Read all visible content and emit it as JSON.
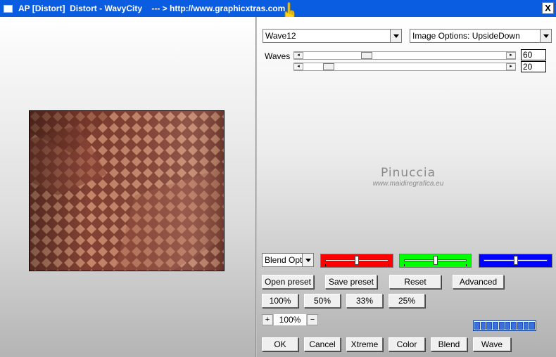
{
  "window": {
    "title": "AP [Distort]  Distort - WavyCity    --- > http://www.graphicxtras.com",
    "close_label": "X"
  },
  "preset_combo": {
    "value": "Wave12"
  },
  "options_combo": {
    "value": "Image Options: UpsideDown"
  },
  "waves": {
    "label": "Waves",
    "slider1": {
      "value": "60",
      "fraction": 0.36
    },
    "slider2": {
      "value": "20",
      "fraction": 0.12
    }
  },
  "watermark": {
    "name": "Pinuccia",
    "url": "www.maidiregrafica.eu"
  },
  "blend_combo": {
    "value": "Blend Optio"
  },
  "color_sliders": [
    {
      "name": "red",
      "color": "#ff0000",
      "fraction": 0.5
    },
    {
      "name": "green",
      "color": "#00ff00",
      "fraction": 0.5
    },
    {
      "name": "blue",
      "color": "#0000ff",
      "fraction": 0.5
    }
  ],
  "buttons": {
    "open_preset": "Open preset",
    "save_preset": "Save preset",
    "reset": "Reset",
    "advanced": "Advanced",
    "zoom100": "100%",
    "zoom50": "50%",
    "zoom33": "33%",
    "zoom25": "25%",
    "ok": "OK",
    "cancel": "Cancel",
    "xtreme": "Xtreme",
    "color": "Color",
    "blend": "Blend",
    "wave": "Wave"
  },
  "zoom": {
    "plus": "+",
    "value": "100%",
    "minus": "−"
  },
  "progress": {
    "segments": 10
  },
  "icons": {
    "window": "window-icon",
    "hand": "pointing-hand-icon",
    "close": "close-icon"
  }
}
